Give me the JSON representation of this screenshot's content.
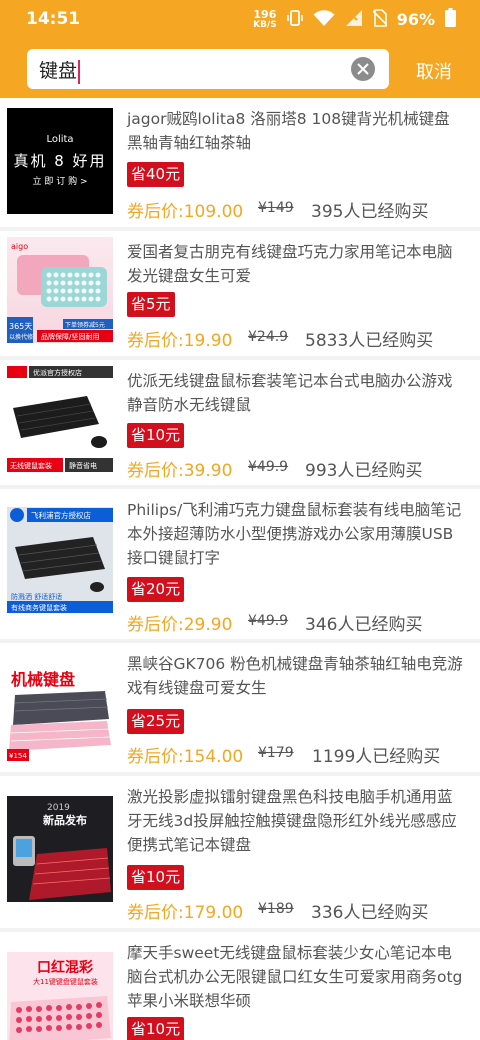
{
  "status": {
    "time": "14:51",
    "net_speed_value": "196",
    "net_speed_unit": "KB/S",
    "battery": "96%"
  },
  "search": {
    "query": "键盘",
    "cancel_label": "取消"
  },
  "labels": {
    "price_prefix": "券后价:"
  },
  "products": [
    {
      "title": "jagor贼鸥lolita8 洛丽塔8 108键背光机械键盘 黑轴青轴红轴茶轴",
      "coupon": "省40元",
      "price": "109.00",
      "original_price": "¥149",
      "sold": "395人已经购买",
      "thumb": {
        "line1": "Lolita",
        "line2": "真机 8 好用",
        "line3": "立 即 订 购 >"
      }
    },
    {
      "title": "爱国者复古朋克有线键盘巧克力家用笔记本电脑发光键盘女生可爱",
      "coupon": "省5元",
      "price": "19.90",
      "original_price": "¥24.9",
      "sold": "5833人已经购买",
      "thumb": {
        "brand": "aigo",
        "badge": "365天",
        "badge_sub": "以换代修",
        "tag1": "下单领券减5元",
        "tag2": "品牌保障/坚固耐用"
      }
    },
    {
      "title": "优派无线键盘鼠标套装笔记本台式电脑办公游戏静音防水无线键鼠",
      "coupon": "省10元",
      "price": "39.90",
      "original_price": "¥49.9",
      "sold": "993人已经购买",
      "thumb": {
        "store": "优派官方授权店",
        "tag1": "无线键鼠套装",
        "tag2": "静音省电"
      }
    },
    {
      "title": "Philips/飞利浦巧克力键盘鼠标套装有线电脑笔记本外接超薄防水小型便携游戏办公家用薄膜USB接口键鼠打字",
      "coupon": "省20元",
      "price": "29.90",
      "original_price": "¥49.9",
      "sold": "346人已经购买",
      "thumb": {
        "store": "飞利浦官方授权店",
        "tag1": "防溅洒 舒适舒适",
        "tag2": "有线商务键鼠套装"
      }
    },
    {
      "title": "黑峡谷GK706 粉色机械键盘青轴茶轴红轴电竞游戏有线键盘可爱女生",
      "coupon": "省25元",
      "price": "154.00",
      "original_price": "¥179",
      "sold": "1199人已经购买",
      "thumb": {
        "brand": "机械键盘",
        "price_tag": "¥154"
      }
    },
    {
      "title": "激光投影虚拟镭射键盘黑色科技电脑手机通用蓝牙无线3d投屏触控触摸键盘隐形红外线光感感应便携式笔记本键盘",
      "coupon": "省10元",
      "price": "179.00",
      "original_price": "¥189",
      "sold": "336人已经购买",
      "thumb": {
        "year": "2019",
        "label": "新品发布"
      }
    },
    {
      "title": "摩天手sweet无线键盘鼠标套装少女心笔记本电脑台式机办公无限键鼠口红女生可爱家用商务otg苹果小米联想华硕",
      "coupon": "省10元",
      "thumb": {
        "label": "口红混彩",
        "sub": "大11键键盘键鼠套装"
      }
    }
  ],
  "colors": {
    "accent": "#f5a623",
    "coupon_bg": "#d10f1d"
  }
}
